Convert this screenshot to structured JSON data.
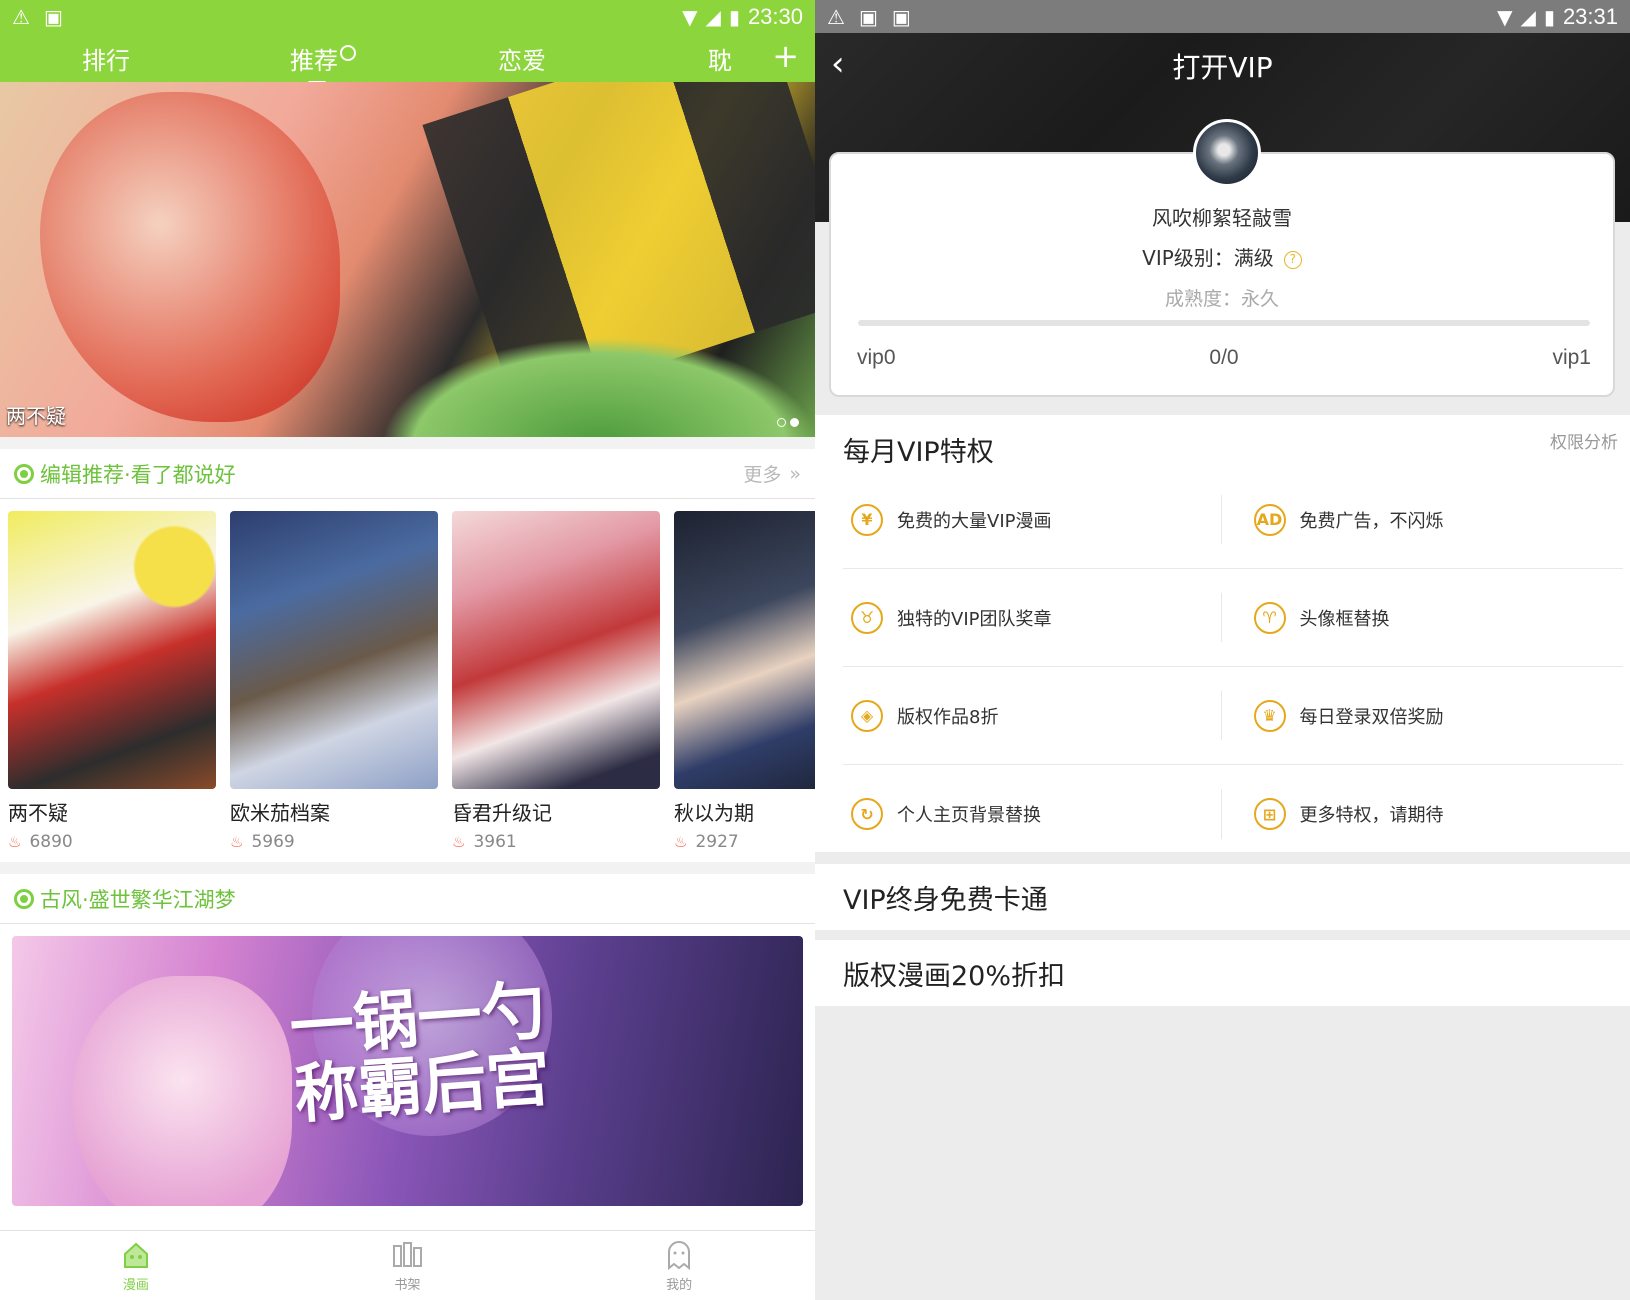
{
  "left": {
    "status": {
      "time": "23:30"
    },
    "nav_tabs": [
      {
        "label": "排行"
      },
      {
        "label": "推荐"
      },
      {
        "label": "恋爱"
      },
      {
        "label": "耽"
      }
    ],
    "banner": {
      "caption": "两不疑"
    },
    "section1": {
      "title": "编辑推荐·看了都说好",
      "more": "更多",
      "comics": [
        {
          "title": "两不疑",
          "count": "6890"
        },
        {
          "title": "欧米茄档案",
          "count": "5969"
        },
        {
          "title": "昏君升级记",
          "count": "3961"
        },
        {
          "title": "秋以为期",
          "count": "2927"
        }
      ]
    },
    "section2": {
      "title": "古风·盛世繁华江湖梦",
      "banner_text_line1": "一锅一勺",
      "banner_text_line2": "称霸后宫"
    },
    "tabbar": [
      {
        "label": "漫画"
      },
      {
        "label": "书架"
      },
      {
        "label": "我的"
      }
    ],
    "colors": {
      "accent": "#8dd53d"
    }
  },
  "right": {
    "status": {
      "time": "23:31"
    },
    "title": "打开VIP",
    "user": {
      "name": "风吹柳絮轻敲雪",
      "vip_level": "VIP级别：满级",
      "maturity": "成熟度：永久",
      "progress_fraction": 0,
      "label_start": "vip0",
      "label_mid": "0/0",
      "label_end": "vip1"
    },
    "privileges": {
      "title": "每月VIP特权",
      "analysis": "权限分析",
      "items": [
        {
          "icon": "yen-icon",
          "glyph": "¥",
          "label": "免费的大量VIP漫画"
        },
        {
          "icon": "ad-icon",
          "glyph": "AD",
          "label": "免费广告，不闪烁"
        },
        {
          "icon": "medal-icon",
          "glyph": "♉",
          "label": "独特的VIP团队奖章"
        },
        {
          "icon": "frame-icon",
          "glyph": "♈",
          "label": "头像框替换"
        },
        {
          "icon": "tag-icon",
          "glyph": "◈",
          "label": "版权作品8折"
        },
        {
          "icon": "crown-icon",
          "glyph": "♛",
          "label": "每日登录双倍奖励"
        },
        {
          "icon": "refresh-icon",
          "glyph": "↻",
          "label": "个人主页背景替换"
        },
        {
          "icon": "gift-icon",
          "glyph": "⊞",
          "label": "更多特权，请期待"
        }
      ]
    },
    "row1": "VIP终身免费卡通",
    "row2": "版权漫画20%折扣",
    "colors": {
      "gold": "#e6a81b",
      "progress": "#f3b330"
    }
  }
}
